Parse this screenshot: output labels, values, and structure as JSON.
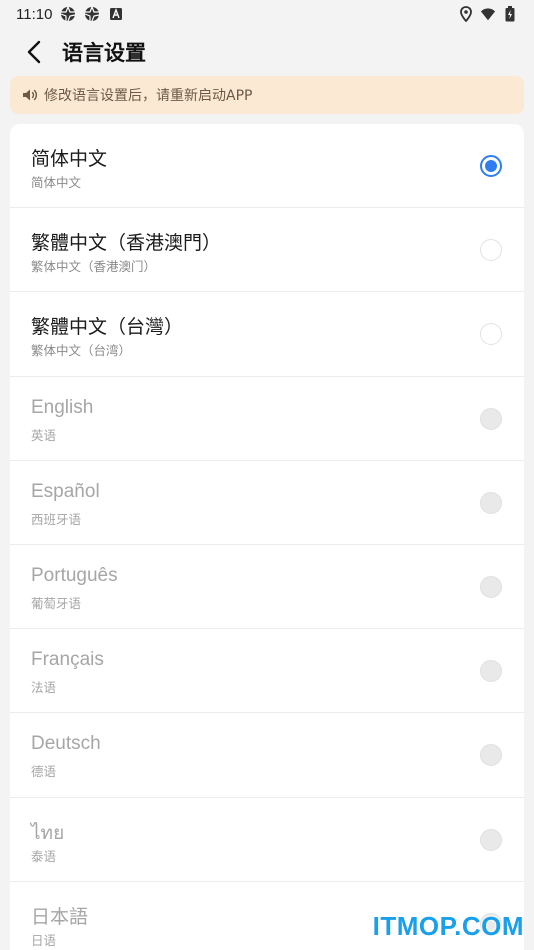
{
  "status_bar": {
    "time": "11:10",
    "icons_left": [
      "aperture-icon",
      "aperture-icon",
      "a-badge-icon"
    ],
    "icons_right": [
      "location-icon",
      "wifi-icon",
      "battery-icon"
    ]
  },
  "header": {
    "title": "语言设置"
  },
  "notice": {
    "text": "修改语言设置后，请重新启动APP"
  },
  "languages": [
    {
      "name": "简体中文",
      "sub": "简体中文",
      "selected": true,
      "enabled": true
    },
    {
      "name": "繁體中文（香港澳門）",
      "sub": "繁体中文（香港澳门）",
      "selected": false,
      "enabled": true
    },
    {
      "name": "繁體中文（台灣）",
      "sub": "繁体中文（台湾）",
      "selected": false,
      "enabled": true
    },
    {
      "name": "English",
      "sub": "英语",
      "selected": false,
      "enabled": false
    },
    {
      "name": "Español",
      "sub": "西班牙语",
      "selected": false,
      "enabled": false
    },
    {
      "name": "Português",
      "sub": "葡萄牙语",
      "selected": false,
      "enabled": false
    },
    {
      "name": "Français",
      "sub": "法语",
      "selected": false,
      "enabled": false
    },
    {
      "name": "Deutsch",
      "sub": "德语",
      "selected": false,
      "enabled": false
    },
    {
      "name": "ไทย",
      "sub": "泰语",
      "selected": false,
      "enabled": false
    },
    {
      "name": "日本語",
      "sub": "日语",
      "selected": false,
      "enabled": false
    }
  ],
  "colors": {
    "accent": "#2f7df1",
    "notice_bg": "#fbe9d3",
    "watermark": "#1aa0ea"
  },
  "watermark": "ITMOP.COM"
}
